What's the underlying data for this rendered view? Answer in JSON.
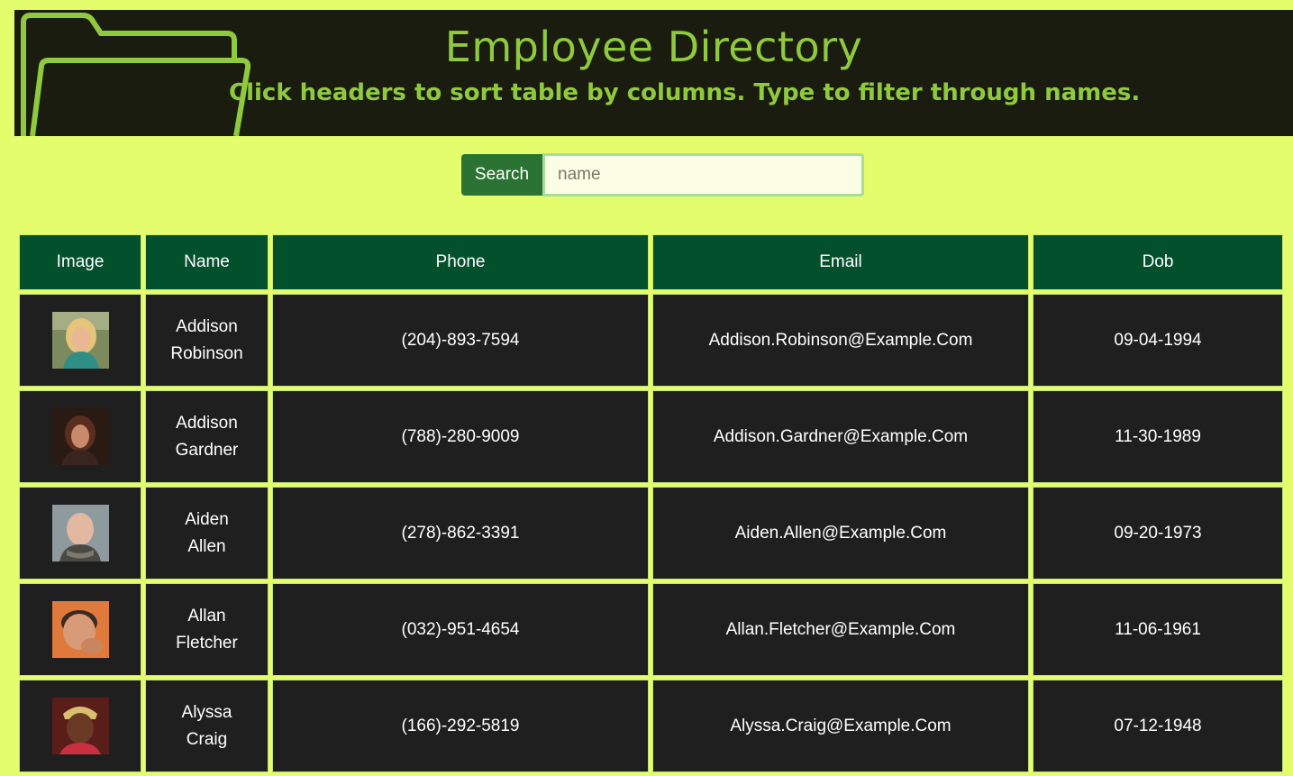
{
  "header": {
    "title": "Employee Directory",
    "subtitle": "Click headers to sort table by columns. Type to filter through names."
  },
  "search": {
    "button_label": "Search",
    "placeholder": "name",
    "value": ""
  },
  "table": {
    "columns": [
      "Image",
      "Name",
      "Phone",
      "Email",
      "Dob"
    ],
    "rows": [
      {
        "name_first": "Addison",
        "name_last": "Robinson",
        "phone": "(204)-893-7594",
        "email": "Addison.Robinson@Example.Com",
        "dob": "09-04-1994"
      },
      {
        "name_first": "Addison",
        "name_last": "Gardner",
        "phone": "(788)-280-9009",
        "email": "Addison.Gardner@Example.Com",
        "dob": "11-30-1989"
      },
      {
        "name_first": "Aiden",
        "name_last": "Allen",
        "phone": "(278)-862-3391",
        "email": "Aiden.Allen@Example.Com",
        "dob": "09-20-1973"
      },
      {
        "name_first": "Allan",
        "name_last": "Fletcher",
        "phone": "(032)-951-4654",
        "email": "Allan.Fletcher@Example.Com",
        "dob": "11-06-1961"
      },
      {
        "name_first": "Alyssa",
        "name_last": "Craig",
        "phone": "(166)-292-5819",
        "email": "Alyssa.Craig@Example.Com",
        "dob": "07-12-1948"
      }
    ]
  },
  "colors": {
    "page_bg": "#e3fd6d",
    "header_bg": "#1b1c10",
    "accent_green": "#8fca3e",
    "table_header_bg": "#03502c",
    "cell_bg": "#1f1f1f",
    "search_button_bg": "#2b7332"
  },
  "icons": {
    "header_decoration": "folder-icon"
  }
}
